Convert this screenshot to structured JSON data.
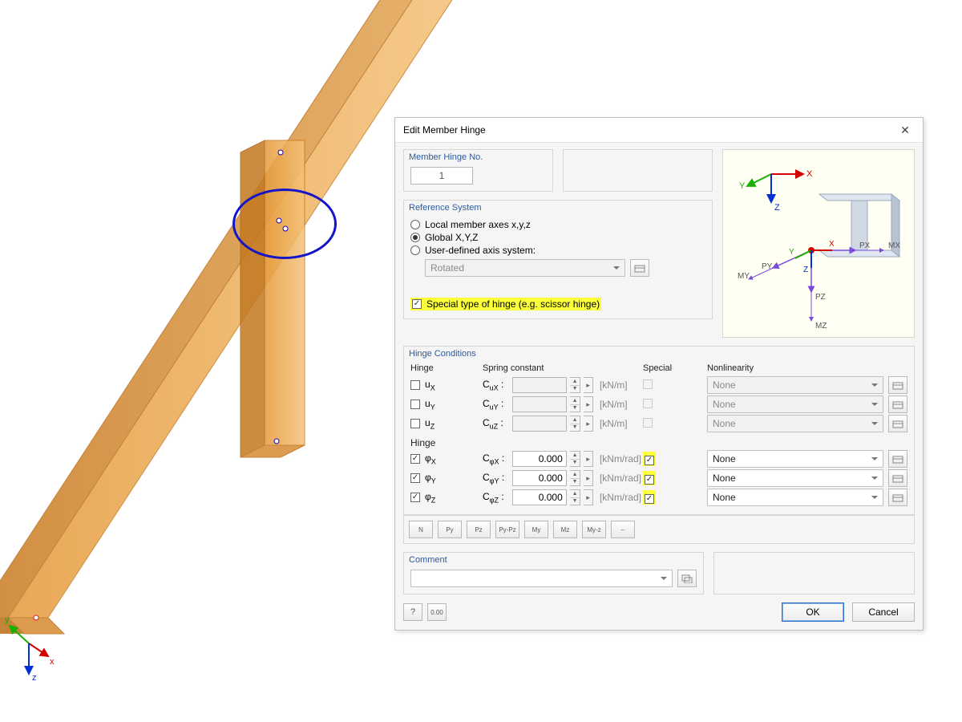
{
  "dialog": {
    "title": "Edit Member Hinge",
    "hinge_no": {
      "label": "Member Hinge No.",
      "value": "1"
    },
    "ref": {
      "label": "Reference System",
      "options": {
        "local": {
          "label": "Local member axes x,y,z",
          "checked": false
        },
        "global": {
          "label": "Global X,Y,Z",
          "checked": true
        },
        "user": {
          "label": "User-defined axis system:",
          "checked": false
        }
      },
      "axis_dd": "Rotated"
    },
    "special": {
      "checked": true,
      "label": "Special type of hinge (e.g. scissor hinge)"
    },
    "hc": {
      "label": "Hinge Conditions",
      "headers": {
        "hinge": "Hinge",
        "spring": "Spring constant",
        "special": "Special",
        "nl": "Nonlinearity"
      },
      "trans_label": "Hinge",
      "rot_label": "Hinge",
      "rows_t": [
        {
          "name": "uX",
          "sc": "CuX",
          "val": "",
          "unit": "[kN/m]",
          "hinge": false,
          "special": false,
          "nl": "None"
        },
        {
          "name": "uY",
          "sc": "CuY",
          "val": "",
          "unit": "[kN/m]",
          "hinge": false,
          "special": false,
          "nl": "None"
        },
        {
          "name": "uZ",
          "sc": "CuZ",
          "val": "",
          "unit": "[kN/m]",
          "hinge": false,
          "special": false,
          "nl": "None"
        }
      ],
      "rows_r": [
        {
          "name": "φX",
          "sc": "CφX",
          "val": "0.000",
          "unit": "[kNm/rad]",
          "hinge": true,
          "special": true,
          "nl": "None"
        },
        {
          "name": "φY",
          "sc": "CφY",
          "val": "0.000",
          "unit": "[kNm/rad]",
          "hinge": true,
          "special": true,
          "nl": "None"
        },
        {
          "name": "φZ",
          "sc": "CφZ",
          "val": "0.000",
          "unit": "[kNm/rad]",
          "hinge": true,
          "special": true,
          "nl": "None"
        }
      ]
    },
    "presets": [
      "N",
      "Py",
      "Pz",
      "Py-Pz",
      "My",
      "Mz",
      "My-z",
      "–"
    ],
    "comment": {
      "label": "Comment",
      "value": ""
    },
    "buttons": {
      "ok": "OK",
      "cancel": "Cancel"
    },
    "preview_labels": {
      "x": "X",
      "y": "Y",
      "z": "Z",
      "px": "PX",
      "py": "PY",
      "pz": "PZ",
      "mx": "MX",
      "my": "MY",
      "mz": "MZ"
    }
  },
  "world_axes": {
    "x": "x",
    "y": "y",
    "z": "z"
  }
}
